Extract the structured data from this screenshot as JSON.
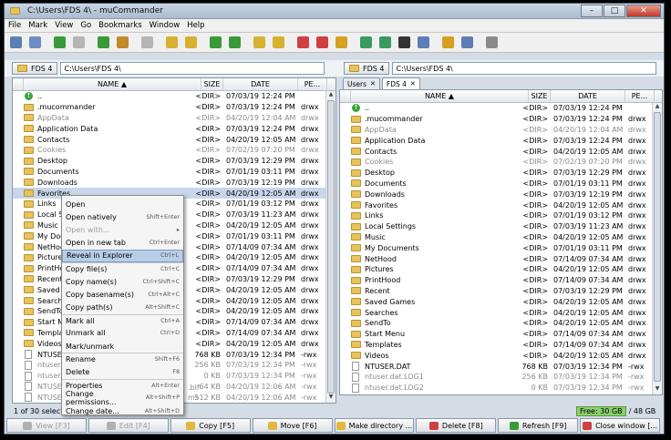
{
  "window": {
    "title": "C:\\Users\\FDS 4\\ - muCommander",
    "btn_min": "–",
    "btn_max": "□",
    "btn_close": "✕"
  },
  "menu": [
    "File",
    "Mark",
    "View",
    "Go",
    "Bookmarks",
    "Window",
    "Help"
  ],
  "toolbar_icons": [
    {
      "name": "new-window-icon",
      "color": "#5b7fb5"
    },
    {
      "name": "preferences-icon",
      "color": "#6b8fc5"
    },
    {
      "sep": true
    },
    {
      "name": "back-icon",
      "color": "#3a9a3a"
    },
    {
      "name": "forward-icon",
      "color": "#b5b5b5"
    },
    {
      "sep": true
    },
    {
      "name": "parent-folder-icon",
      "color": "#3a9a3a"
    },
    {
      "name": "home-icon",
      "color": "#c08a2a"
    },
    {
      "sep": true
    },
    {
      "name": "stop-icon",
      "color": "#b5b5b5"
    },
    {
      "sep": true
    },
    {
      "name": "mark-icon",
      "color": "#d8b030"
    },
    {
      "name": "unmark-icon",
      "color": "#d8b030"
    },
    {
      "sep": true
    },
    {
      "name": "swap-folders-icon",
      "color": "#3a9a3a"
    },
    {
      "name": "set-same-folder-icon",
      "color": "#3a9a3a"
    },
    {
      "sep": true
    },
    {
      "name": "pack-icon",
      "color": "#d8b030"
    },
    {
      "name": "unpack-icon",
      "color": "#d8b030"
    },
    {
      "sep": true
    },
    {
      "name": "bookmark-add-icon",
      "color": "#d04040"
    },
    {
      "name": "edit-bookmarks-icon",
      "color": "#d04040"
    },
    {
      "name": "key-icon",
      "color": "#d8a020"
    },
    {
      "sep": true
    },
    {
      "name": "connect-server-icon",
      "color": "#3a9a60"
    },
    {
      "name": "run-command-icon",
      "color": "#3a9a60"
    },
    {
      "name": "terminal-icon",
      "color": "#333333"
    },
    {
      "name": "email-icon",
      "color": "#5b7fb5"
    },
    {
      "sep": true
    },
    {
      "name": "wand-icon",
      "color": "#d8a020"
    },
    {
      "name": "help-icon",
      "color": "#5b7fb5"
    },
    {
      "sep": true
    },
    {
      "name": "gear-icon",
      "color": "#8a8a8a"
    }
  ],
  "left": {
    "drive": "FDS 4",
    "path": "C:\\Users\\FDS 4\\",
    "columns": {
      "name": "NAME ▲",
      "size": "SIZE",
      "date": "DATE",
      "perm": "PE..."
    },
    "rows": [
      {
        "n": "..",
        "s": "<DIR>",
        "d": "07/03/19 12:24 PM",
        "p": "",
        "t": "up"
      },
      {
        "n": ".mucommander",
        "s": "<DIR>",
        "d": "07/03/19 12:24 PM",
        "p": "drwx",
        "t": "dir"
      },
      {
        "n": "AppData",
        "s": "<DIR>",
        "d": "04/20/19 12:04 AM",
        "p": "drwx",
        "t": "dir",
        "dim": true
      },
      {
        "n": "Application Data",
        "s": "<DIR>",
        "d": "07/03/19 12:24 PM",
        "p": "drwx",
        "t": "dir"
      },
      {
        "n": "Contacts",
        "s": "<DIR>",
        "d": "04/20/19 12:05 AM",
        "p": "drwx",
        "t": "dir"
      },
      {
        "n": "Cookies",
        "s": "<DIR>",
        "d": "07/02/19 07:20 PM",
        "p": "drwx",
        "t": "dir",
        "dim": true
      },
      {
        "n": "Desktop",
        "s": "<DIR>",
        "d": "07/03/19 12:29 PM",
        "p": "drwx",
        "t": "dir"
      },
      {
        "n": "Documents",
        "s": "<DIR>",
        "d": "07/01/19 03:11 PM",
        "p": "drwx",
        "t": "dir"
      },
      {
        "n": "Downloads",
        "s": "<DIR>",
        "d": "07/03/19 12:19 PM",
        "p": "drwx",
        "t": "dir"
      },
      {
        "n": "Favorites",
        "s": "<DIR>",
        "d": "04/20/19 12:05 AM",
        "p": "drwx",
        "t": "dir",
        "sel": true
      },
      {
        "n": "Links",
        "s": "<DIR>",
        "d": "07/01/19 03:12 PM",
        "p": "drwx",
        "t": "dir"
      },
      {
        "n": "Local Set",
        "s": "<DIR>",
        "d": "07/03/19 11:23 AM",
        "p": "drwx",
        "t": "dir"
      },
      {
        "n": "Music",
        "s": "<DIR>",
        "d": "04/20/19 12:05 AM",
        "p": "drwx",
        "t": "dir"
      },
      {
        "n": "My Docu",
        "s": "<DIR>",
        "d": "07/01/19 03:11 PM",
        "p": "drwx",
        "t": "dir"
      },
      {
        "n": "NetHood",
        "s": "<DIR>",
        "d": "07/14/09 07:34 AM",
        "p": "drwx",
        "t": "dir"
      },
      {
        "n": "Pictures",
        "s": "<DIR>",
        "d": "04/20/19 12:05 AM",
        "p": "drwx",
        "t": "dir"
      },
      {
        "n": "PrintHoo",
        "s": "<DIR>",
        "d": "07/14/09 07:34 AM",
        "p": "drwx",
        "t": "dir"
      },
      {
        "n": "Recent",
        "s": "<DIR>",
        "d": "07/03/19 12:29 PM",
        "p": "drwx",
        "t": "dir"
      },
      {
        "n": "Saved Ga",
        "s": "<DIR>",
        "d": "04/20/19 12:05 AM",
        "p": "drwx",
        "t": "dir"
      },
      {
        "n": "Searches",
        "s": "<DIR>",
        "d": "04/20/19 12:05 AM",
        "p": "drwx",
        "t": "dir"
      },
      {
        "n": "SendTo",
        "s": "<DIR>",
        "d": "04/20/19 12:05 AM",
        "p": "drwx",
        "t": "dir"
      },
      {
        "n": "Start Me",
        "s": "<DIR>",
        "d": "07/14/09 07:34 AM",
        "p": "drwx",
        "t": "dir"
      },
      {
        "n": "Template",
        "s": "<DIR>",
        "d": "07/14/09 07:34 AM",
        "p": "drwx",
        "t": "dir"
      },
      {
        "n": "Videos",
        "s": "<DIR>",
        "d": "04/20/19 12:05 AM",
        "p": "drwx",
        "t": "dir"
      },
      {
        "n": "NTUSER.",
        "s": "768 KB",
        "d": "07/03/19 12:34 PM",
        "p": "-rwx",
        "t": "file"
      },
      {
        "n": "ntuser.d",
        "s": "256 KB",
        "d": "07/03/19 12:34 PM",
        "p": "-rwx",
        "t": "file",
        "dim": true
      },
      {
        "n": "ntuser.d",
        "s": "0 KB",
        "d": "07/03/19 12:34 PM",
        "p": "-rwx",
        "t": "file",
        "dim": true
      },
      {
        "n": "NTUSER.",
        "s": "64 KB",
        "d": "04/20/19 12:06 AM",
        "p": "-rwx",
        "t": "file",
        "dim": true
      },
      {
        "n": "NTUSER.",
        "s": "512 KB",
        "d": "04/20/19 12:06 AM",
        "p": "-rwx",
        "t": "file",
        "dim": true
      }
    ],
    "status": "1 of 30 select"
  },
  "right": {
    "drive": "FDS 4",
    "path": "C:\\Users\\FDS 4\\",
    "tabs": [
      "Users",
      "FDS 4"
    ],
    "columns": {
      "name": "NAME ▲",
      "size": "SIZE",
      "date": "DATE",
      "perm": "PE..."
    },
    "rows": [
      {
        "n": "..",
        "s": "<DIR>",
        "d": "07/03/19 12:24 PM",
        "p": "",
        "t": "up"
      },
      {
        "n": ".mucommander",
        "s": "<DIR>",
        "d": "07/03/19 12:24 PM",
        "p": "drwx",
        "t": "dir"
      },
      {
        "n": "AppData",
        "s": "<DIR>",
        "d": "04/20/19 12:04 AM",
        "p": "drwx",
        "t": "dir",
        "dim": true
      },
      {
        "n": "Application Data",
        "s": "<DIR>",
        "d": "07/03/19 12:24 PM",
        "p": "drwx",
        "t": "dir"
      },
      {
        "n": "Contacts",
        "s": "<DIR>",
        "d": "04/20/19 12:05 AM",
        "p": "drwx",
        "t": "dir"
      },
      {
        "n": "Cookies",
        "s": "<DIR>",
        "d": "07/02/19 07:20 PM",
        "p": "drwx",
        "t": "dir",
        "dim": true
      },
      {
        "n": "Desktop",
        "s": "<DIR>",
        "d": "07/03/19 12:29 PM",
        "p": "drwx",
        "t": "dir"
      },
      {
        "n": "Documents",
        "s": "<DIR>",
        "d": "07/01/19 03:11 PM",
        "p": "drwx",
        "t": "dir"
      },
      {
        "n": "Downloads",
        "s": "<DIR>",
        "d": "07/03/19 12:19 PM",
        "p": "drwx",
        "t": "dir"
      },
      {
        "n": "Favorites",
        "s": "<DIR>",
        "d": "04/20/19 12:05 AM",
        "p": "drwx",
        "t": "dir"
      },
      {
        "n": "Links",
        "s": "<DIR>",
        "d": "07/01/19 03:12 PM",
        "p": "drwx",
        "t": "dir"
      },
      {
        "n": "Local Settings",
        "s": "<DIR>",
        "d": "07/03/19 11:23 AM",
        "p": "drwx",
        "t": "dir"
      },
      {
        "n": "Music",
        "s": "<DIR>",
        "d": "04/20/19 12:05 AM",
        "p": "drwx",
        "t": "dir"
      },
      {
        "n": "My Documents",
        "s": "<DIR>",
        "d": "07/01/19 03:11 PM",
        "p": "drwx",
        "t": "dir"
      },
      {
        "n": "NetHood",
        "s": "<DIR>",
        "d": "07/14/09 07:34 AM",
        "p": "drwx",
        "t": "dir"
      },
      {
        "n": "Pictures",
        "s": "<DIR>",
        "d": "04/20/19 12:05 AM",
        "p": "drwx",
        "t": "dir"
      },
      {
        "n": "PrintHood",
        "s": "<DIR>",
        "d": "07/14/09 07:34 AM",
        "p": "drwx",
        "t": "dir"
      },
      {
        "n": "Recent",
        "s": "<DIR>",
        "d": "07/03/19 12:29 PM",
        "p": "drwx",
        "t": "dir"
      },
      {
        "n": "Saved Games",
        "s": "<DIR>",
        "d": "04/20/19 12:05 AM",
        "p": "drwx",
        "t": "dir"
      },
      {
        "n": "Searches",
        "s": "<DIR>",
        "d": "04/20/19 12:05 AM",
        "p": "drwx",
        "t": "dir"
      },
      {
        "n": "SendTo",
        "s": "<DIR>",
        "d": "04/20/19 12:05 AM",
        "p": "drwx",
        "t": "dir"
      },
      {
        "n": "Start Menu",
        "s": "<DIR>",
        "d": "07/14/09 07:34 AM",
        "p": "drwx",
        "t": "dir"
      },
      {
        "n": "Templates",
        "s": "<DIR>",
        "d": "07/14/09 07:34 AM",
        "p": "drwx",
        "t": "dir"
      },
      {
        "n": "Videos",
        "s": "<DIR>",
        "d": "04/20/19 12:05 AM",
        "p": "drwx",
        "t": "dir"
      },
      {
        "n": "NTUSER.DAT",
        "s": "768 KB",
        "d": "07/03/19 12:34 PM",
        "p": "-rwx",
        "t": "file"
      },
      {
        "n": "ntuser.dat.LOG1",
        "s": "256 KB",
        "d": "07/03/19 12:34 PM",
        "p": "-rwx",
        "t": "file",
        "dim": true
      },
      {
        "n": "ntuser.dat.LOG2",
        "s": "0 KB",
        "d": "07/03/19 12:34 PM",
        "p": "-rwx",
        "t": "file",
        "dim": true
      }
    ],
    "free_space": "Free: 30 GB",
    "total_space": "/ 48 GB"
  },
  "context_menu": [
    {
      "label": "Open",
      "shortcut": ""
    },
    {
      "label": "Open natively",
      "shortcut": "Shift+Enter"
    },
    {
      "label": "Open with...",
      "shortcut": "▸",
      "disabled": true
    },
    {
      "label": "Open in new tab",
      "shortcut": "Ctrl+Enter"
    },
    {
      "label": "Reveal in Explorer",
      "shortcut": "Ctrl+L",
      "highlight": true
    },
    {
      "label": "Copy file(s)",
      "shortcut": "Ctrl+C",
      "sep": true
    },
    {
      "label": "Copy name(s)",
      "shortcut": "Ctrl+Shift+C"
    },
    {
      "label": "Copy basename(s)",
      "shortcut": "Ctrl+Alt+C"
    },
    {
      "label": "Copy path(s)",
      "shortcut": "Alt+Shift+C"
    },
    {
      "label": "Mark all",
      "shortcut": "Ctrl+A",
      "sep": true
    },
    {
      "label": "Unmark all",
      "shortcut": "Ctrl+D"
    },
    {
      "label": "Mark/unmark",
      "shortcut": ""
    },
    {
      "label": "Rename",
      "shortcut": "Shift+F6",
      "sep": true
    },
    {
      "label": "Delete",
      "shortcut": "F8"
    },
    {
      "label": "Properties",
      "shortcut": "Alt+Enter",
      "sep": true
    },
    {
      "label": "Change permissions...",
      "shortcut": "Alt+Shift+P"
    },
    {
      "label": "Change date...",
      "shortcut": "Alt+Shift+D"
    }
  ],
  "menu_obscured_tail": {
    "row27": ".blf",
    "row28": "ms"
  },
  "function_buttons": [
    {
      "label": "View [F3]",
      "icon": "view-icon",
      "color": "#b0b0b0",
      "disabled": true
    },
    {
      "label": "Edit [F4]",
      "icon": "edit-icon",
      "color": "#b0b0b0",
      "disabled": true
    },
    {
      "label": "Copy [F5]",
      "icon": "copy-icon",
      "color": "#e0b840"
    },
    {
      "label": "Move [F6]",
      "icon": "move-icon",
      "color": "#e0b840"
    },
    {
      "label": "Make directory ...",
      "icon": "make-directory-icon",
      "color": "#e0b840"
    },
    {
      "label": "Delete [F8]",
      "icon": "delete-icon",
      "color": "#d04040"
    },
    {
      "label": "Refresh [F9]",
      "icon": "refresh-icon",
      "color": "#3a9a3a"
    },
    {
      "label": "Close window [...",
      "icon": "close-window-icon",
      "color": "#d04040"
    }
  ]
}
